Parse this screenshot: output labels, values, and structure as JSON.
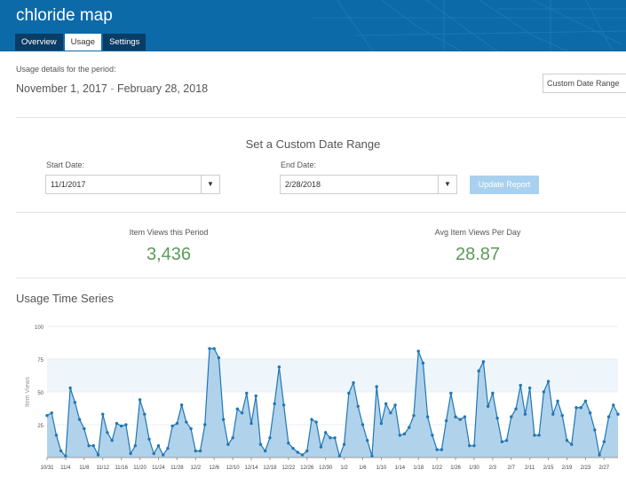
{
  "header": {
    "title": "chloride map",
    "tabs": [
      {
        "label": "Overview",
        "active": false
      },
      {
        "label": "Usage",
        "active": true
      },
      {
        "label": "Settings",
        "active": false
      }
    ]
  },
  "period": {
    "label": "Usage details for the period:",
    "start": "November 1, 2017",
    "separator": " - ",
    "end": "February 28, 2018",
    "range_option": "Custom Date Range"
  },
  "custom_range": {
    "title": "Set a Custom Date Range",
    "start_label": "Start Date:",
    "start_value": "11/1/2017",
    "end_label": "End Date:",
    "end_value": "2/28/2018",
    "update_label": "Update Report"
  },
  "stats": {
    "views_label": "Item Views this Period",
    "views_value": "3,436",
    "avg_label": "Avg Item Views Per Day",
    "avg_value": "28.87"
  },
  "timeseries": {
    "title": "Usage Time Series"
  },
  "colors": {
    "header": "#0c6aa9",
    "tab_dark": "#0a3d66",
    "stat": "#5c9a58",
    "line": "#1f77b4",
    "area": "#a9cde9"
  },
  "chart_data": {
    "type": "area",
    "ylabel": "Item Views",
    "ylim": [
      0,
      100
    ],
    "yticks": [
      25,
      50,
      75,
      100
    ],
    "band": [
      50,
      75
    ],
    "x_tick_labels": [
      "10/31",
      "11/4",
      "11/8",
      "11/12",
      "11/16",
      "11/20",
      "11/24",
      "11/28",
      "12/2",
      "12/6",
      "12/10",
      "12/14",
      "12/18",
      "12/22",
      "12/26",
      "12/30",
      "1/2",
      "1/6",
      "1/10",
      "1/14",
      "1/18",
      "1/22",
      "1/26",
      "1/30",
      "2/3",
      "2/7",
      "2/11",
      "2/15",
      "2/19",
      "2/23",
      "2/27"
    ],
    "values": [
      32,
      34,
      17,
      5,
      1,
      53,
      42,
      29,
      22,
      9,
      9,
      2,
      33,
      19,
      13,
      26,
      24,
      25,
      3,
      9,
      44,
      33,
      14,
      3,
      9,
      2,
      7,
      24,
      26,
      40,
      27,
      22,
      5,
      5,
      25,
      83,
      83,
      76,
      29,
      10,
      15,
      37,
      34,
      49,
      26,
      47,
      10,
      5,
      15,
      41,
      69,
      40,
      11,
      7,
      4,
      2,
      5,
      29,
      27,
      8,
      19,
      15,
      15,
      1,
      10,
      49,
      57,
      39,
      25,
      13,
      1,
      54,
      26,
      41,
      34,
      40,
      17,
      18,
      23,
      32,
      81,
      72,
      31,
      17,
      6,
      6,
      28,
      49,
      31,
      29,
      31,
      9,
      9,
      66,
      73,
      39,
      49,
      30,
      12,
      13,
      31,
      37,
      55,
      33,
      53,
      17,
      17,
      50,
      58,
      33,
      43,
      32,
      13,
      10,
      38,
      38,
      43,
      34,
      21,
      2,
      12,
      31,
      40,
      33
    ]
  }
}
